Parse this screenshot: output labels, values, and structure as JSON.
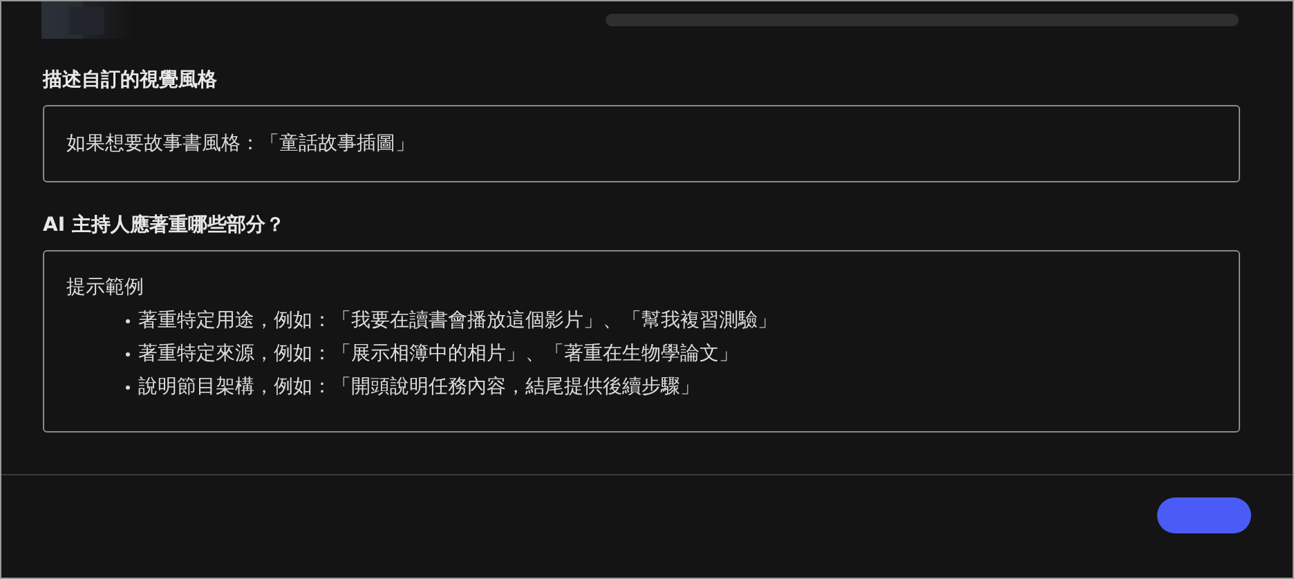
{
  "sections": [
    {
      "label": "描述自訂的視覺風格",
      "kind": "single",
      "value": "如果想要故事書風格：「童話故事插圖」"
    },
    {
      "label": "AI 主持人應著重哪些部分？",
      "kind": "list",
      "heading": "提示範例",
      "items": [
        "著重特定用途，例如：「我要在讀書會播放這個影片」、「幫我複習測驗」",
        "著重特定來源，例如：「展示相簿中的相片」、「著重在生物學論文」",
        "說明節目架構，例如：「開頭說明任務內容，結尾提供後續步驟」"
      ]
    }
  ]
}
